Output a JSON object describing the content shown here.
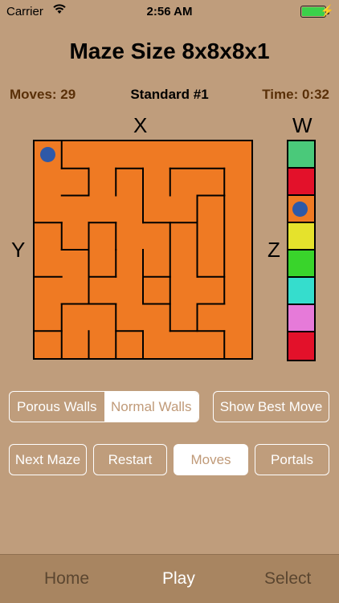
{
  "status": {
    "carrier": "Carrier",
    "time": "2:56 AM"
  },
  "title": "Maze Size 8x8x8x1",
  "info": {
    "moves": "Moves: 29",
    "puzzle": "Standard #1",
    "time": "Time: 0:32"
  },
  "axes": {
    "x": "X",
    "y": "Y",
    "z": "Z",
    "w": "W"
  },
  "maze_walls": [
    [
      [
        1,
        0
      ],
      [
        1,
        1
      ]
    ],
    [
      [
        1,
        1
      ],
      [
        2,
        1
      ]
    ],
    [
      [
        2,
        1
      ],
      [
        2,
        2
      ]
    ],
    [
      [
        1,
        2
      ],
      [
        2,
        2
      ]
    ],
    [
      [
        3,
        1
      ],
      [
        3,
        2
      ]
    ],
    [
      [
        3,
        1
      ],
      [
        4,
        1
      ]
    ],
    [
      [
        5,
        1
      ],
      [
        7,
        1
      ]
    ],
    [
      [
        7,
        1
      ],
      [
        7,
        2
      ]
    ],
    [
      [
        5,
        1
      ],
      [
        5,
        2
      ]
    ],
    [
      [
        4,
        1
      ],
      [
        4,
        3
      ]
    ],
    [
      [
        4,
        3
      ],
      [
        6,
        3
      ]
    ],
    [
      [
        6,
        2
      ],
      [
        6,
        3
      ]
    ],
    [
      [
        6,
        2
      ],
      [
        7,
        2
      ]
    ],
    [
      [
        0,
        3
      ],
      [
        1,
        3
      ]
    ],
    [
      [
        1,
        3
      ],
      [
        1,
        4
      ]
    ],
    [
      [
        2,
        3
      ],
      [
        3,
        3
      ]
    ],
    [
      [
        2,
        3
      ],
      [
        2,
        4
      ]
    ],
    [
      [
        3,
        3
      ],
      [
        3,
        4
      ]
    ],
    [
      [
        5,
        3
      ],
      [
        5,
        5
      ]
    ],
    [
      [
        6,
        3
      ],
      [
        6,
        5
      ]
    ],
    [
      [
        7,
        2
      ],
      [
        7,
        6
      ]
    ],
    [
      [
        1,
        4
      ],
      [
        2,
        4
      ]
    ],
    [
      [
        0,
        5
      ],
      [
        1,
        5
      ]
    ],
    [
      [
        2,
        4
      ],
      [
        2,
        6
      ]
    ],
    [
      [
        3,
        4
      ],
      [
        3,
        5
      ]
    ],
    [
      [
        4,
        4
      ],
      [
        4,
        6
      ]
    ],
    [
      [
        2,
        5
      ],
      [
        3,
        5
      ]
    ],
    [
      [
        4,
        5
      ],
      [
        5,
        5
      ]
    ],
    [
      [
        6,
        5
      ],
      [
        7,
        5
      ]
    ],
    [
      [
        1,
        6
      ],
      [
        2,
        6
      ]
    ],
    [
      [
        1,
        6
      ],
      [
        1,
        8
      ]
    ],
    [
      [
        2,
        6
      ],
      [
        3,
        6
      ]
    ],
    [
      [
        3,
        6
      ],
      [
        3,
        8
      ]
    ],
    [
      [
        4,
        6
      ],
      [
        5,
        6
      ]
    ],
    [
      [
        5,
        5
      ],
      [
        5,
        7
      ]
    ],
    [
      [
        6,
        6
      ],
      [
        7,
        6
      ]
    ],
    [
      [
        6,
        6
      ],
      [
        6,
        7
      ]
    ],
    [
      [
        0,
        7
      ],
      [
        1,
        7
      ]
    ],
    [
      [
        2,
        7
      ],
      [
        2,
        8
      ]
    ],
    [
      [
        3,
        7
      ],
      [
        4,
        7
      ]
    ],
    [
      [
        4,
        7
      ],
      [
        4,
        8
      ]
    ],
    [
      [
        5,
        7
      ],
      [
        7,
        7
      ]
    ],
    [
      [
        7,
        7
      ],
      [
        7,
        8
      ]
    ]
  ],
  "player_cell": [
    0,
    0
  ],
  "w_levels": [
    {
      "color": "#4ac97a"
    },
    {
      "color": "#e3112a"
    },
    {
      "color": "#ef7a23"
    },
    {
      "color": "#e5e22c"
    },
    {
      "color": "#39d42b"
    },
    {
      "color": "#35ddcd"
    },
    {
      "color": "#e67ad9"
    },
    {
      "color": "#e3112a"
    }
  ],
  "w_current": 2,
  "buttons": {
    "porous": "Porous Walls",
    "normal": "Normal Walls",
    "best": "Show Best Move",
    "next": "Next Maze",
    "restart": "Restart",
    "moves": "Moves",
    "portals": "Portals"
  },
  "tabs": {
    "home": "Home",
    "play": "Play",
    "select": "Select"
  }
}
